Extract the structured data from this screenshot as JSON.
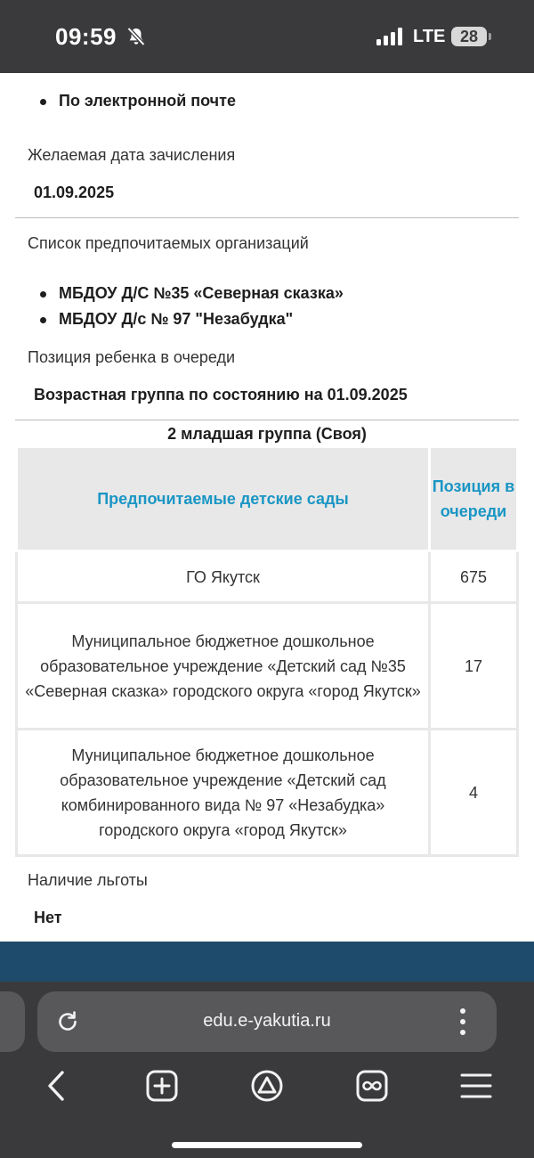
{
  "status_bar": {
    "time": "09:59",
    "network": "LTE",
    "battery": "28",
    "icons": [
      "bell-muted-icon",
      "signal-icon",
      "battery-icon"
    ]
  },
  "delivery": {
    "method": "По электронной почте"
  },
  "enrollment_date": {
    "label": "Желаемая дата зачисления",
    "value": "01.09.2025"
  },
  "preferred_orgs": {
    "label": "Список предпочитаемых организаций",
    "items": [
      "МБДОУ Д/С №35 «Северная сказка»",
      "МБДОУ Д/с № 97 \"Незабудка\""
    ]
  },
  "queue": {
    "label": "Позиция ребенка в очереди",
    "age_group_label": "Возрастная группа по состоянию на 01.09.2025",
    "caption": "2 младшая группа (Своя)",
    "headers": {
      "name": "Предпочитаемые детские сады",
      "position": "Позиция в очереди"
    },
    "rows": [
      {
        "name": "ГО Якутск",
        "position": "675"
      },
      {
        "name": "Муниципальное бюджетное дошкольное образовательное учреждение «Детский сад №35 «Северная сказка» городского округа «город Якутск»",
        "position": "17"
      },
      {
        "name": "Муниципальное бюджетное дошкольное образовательное учреждение «Детский сад комбинированного вида № 97 «Незабудка» городского округа «город Якутск»",
        "position": "4"
      }
    ]
  },
  "benefit": {
    "label": "Наличие льготы",
    "value": "Нет"
  },
  "browser": {
    "url": "edu.e-yakutia.ru",
    "toolbar_icons": [
      "back-icon",
      "new-tab-icon",
      "alice-icon",
      "tabs-icon",
      "menu-icon"
    ]
  },
  "colors": {
    "accent": "#1a96c4",
    "footer": "#1e4b6b",
    "chrome": "#3a3a3c"
  }
}
